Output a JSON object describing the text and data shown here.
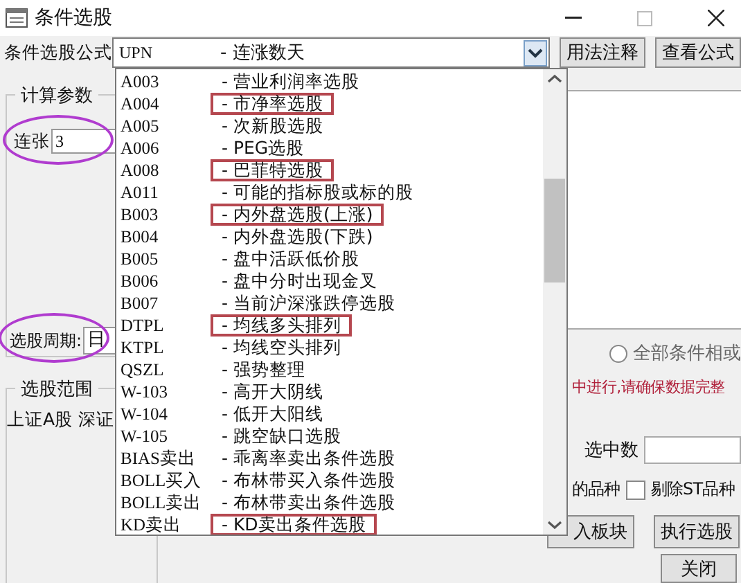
{
  "window": {
    "title": "条件选股"
  },
  "formula": {
    "label": "条件选股公式",
    "code": "UPN",
    "name": "- 连涨数天"
  },
  "buttons": [
    {
      "label": "用法注释"
    },
    {
      "label": "查看公式"
    }
  ],
  "params_group": {
    "title": "计算参数",
    "params": [
      {
        "kind": "input",
        "label": "连张",
        "value": "3",
        "circled": true
      },
      {
        "kind": "combo",
        "label": "选股周期:",
        "value": "日",
        "circled": true
      }
    ]
  },
  "range_group": {
    "title": "选股范围",
    "text": "上证A股 深证"
  },
  "dropdown": {
    "items": [
      {
        "code": "A003",
        "name": "- 营业利润率选股",
        "highlighted": false
      },
      {
        "code": "A004",
        "name": "- 市净率选股",
        "highlighted": true
      },
      {
        "code": "A005",
        "name": "- 次新股选股",
        "highlighted": false
      },
      {
        "code": "A006",
        "name": "- PEG选股",
        "highlighted": false
      },
      {
        "code": "A008",
        "name": "- 巴菲特选股",
        "highlighted": true
      },
      {
        "code": "A011",
        "name": "- 可能的指标股或标的股",
        "highlighted": false
      },
      {
        "code": "B003",
        "name": "- 内外盘选股(上涨)",
        "highlighted": true
      },
      {
        "code": "B004",
        "name": "- 内外盘选股(下跌)",
        "highlighted": false
      },
      {
        "code": "B005",
        "name": "- 盘中活跃低价股",
        "highlighted": false
      },
      {
        "code": "B006",
        "name": "- 盘中分时出现金叉",
        "highlighted": false
      },
      {
        "code": "B007",
        "name": "- 当前沪深涨跌停选股",
        "highlighted": false
      },
      {
        "code": "DTPL",
        "name": "- 均线多头排列",
        "highlighted": true
      },
      {
        "code": "KTPL",
        "name": "- 均线空头排列",
        "highlighted": false
      },
      {
        "code": "QSZL",
        "name": "- 强势整理",
        "highlighted": false
      },
      {
        "code": "W-103",
        "name": "- 高开大阴线",
        "highlighted": false
      },
      {
        "code": "W-104",
        "name": "- 低开大阳线",
        "highlighted": false
      },
      {
        "code": "W-105",
        "name": "- 跳空缺口选股",
        "highlighted": false
      },
      {
        "code": "BIAS卖出",
        "name": "- 乖离率卖出条件选股",
        "highlighted": false
      },
      {
        "code": "BOLL买入",
        "name": "- 布林带买入条件选股",
        "highlighted": false
      },
      {
        "code": "BOLL卖出",
        "name": "- 布林带卖出条件选股",
        "highlighted": false
      },
      {
        "code": "KD卖出",
        "name": "- KD卖出条件选股",
        "highlighted": true
      }
    ]
  },
  "right_panel": {
    "radio": {
      "label": "全部条件相或",
      "selected": false
    },
    "notice": "中进行,请确保数据完整",
    "count_label": "选中数",
    "options": [
      {
        "label": "的品种"
      },
      {
        "label": "剔除ST品种",
        "checked": false
      }
    ],
    "action_buttons": [
      {
        "label": "入板块"
      },
      {
        "label": "执行选股"
      }
    ],
    "close_button": {
      "label": "关闭"
    }
  }
}
